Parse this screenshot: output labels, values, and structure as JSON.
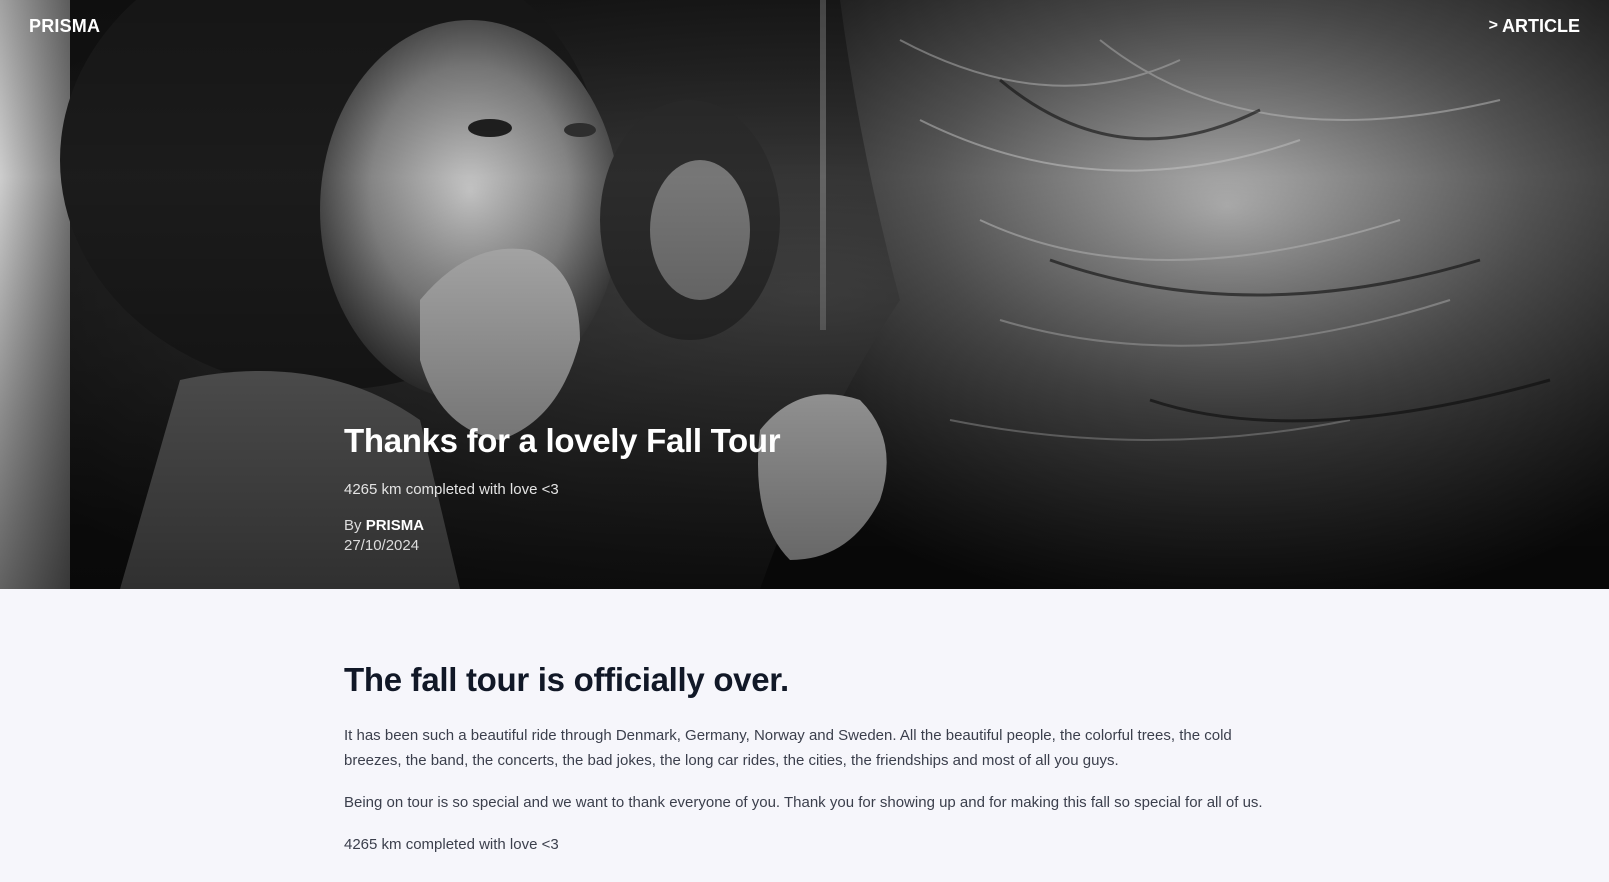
{
  "header": {
    "brand": "PRISMA",
    "nav_article": "ARTICLE",
    "nav_icon": "chevron-right-icon"
  },
  "hero": {
    "title": "Thanks for a lovely Fall Tour",
    "subtitle": "4265 km completed with love <3",
    "by_prefix": "By",
    "author": "PRISMA",
    "date": "27/10/2024",
    "image": "black-and-white-concert-photo"
  },
  "article": {
    "heading": "The fall tour is officially over.",
    "paragraphs": [
      "It has been such a beautiful ride through Denmark, Germany, Norway and Sweden. All the beautiful people, the colorful trees, the cold breezes, the band, the concerts, the bad jokes, the long car rides, the cities, the friendships and most of all you guys.",
      "Being on tour is so special and we want to thank everyone of you. Thank you for showing up and for making this fall so special for all of us.",
      "4265 km completed with love <3"
    ]
  },
  "colors": {
    "page_bg": "#f6f6fb",
    "heading": "#111827",
    "body_text": "#3b3f4c",
    "hero_text": "#ffffff"
  }
}
